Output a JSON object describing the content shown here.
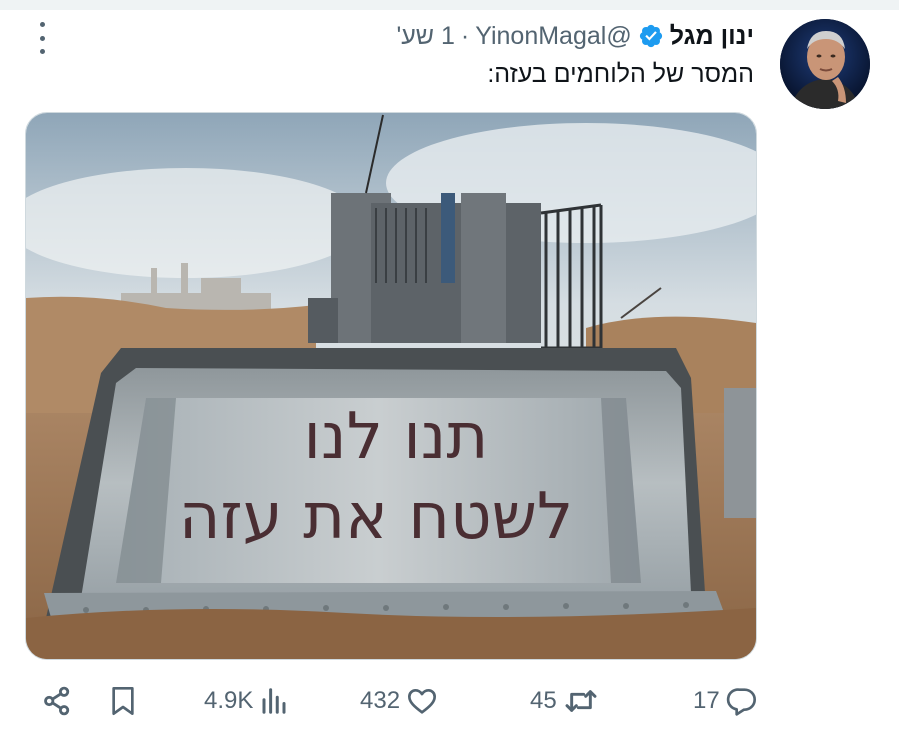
{
  "author": {
    "name": "ינון מגל",
    "handle": "@YinonMagal",
    "separator": "·",
    "time": "1 שע'"
  },
  "tweet": {
    "text": "המסר של הלוחמים בעזה:"
  },
  "media": {
    "blade_line_1": "תנו לנו",
    "blade_line_2": "לשטח את עזה"
  },
  "actions": {
    "replies": "17",
    "retweets": "45",
    "likes": "432",
    "views": "4.9K"
  },
  "icons": [
    "more-icon",
    "verified-icon",
    "share-icon",
    "bookmark-icon",
    "views-icon",
    "like-icon",
    "retweet-icon",
    "reply-icon"
  ],
  "colors": {
    "verified": "#1d9bf0",
    "secondary_text": "#536471",
    "text": "#0f1419"
  }
}
